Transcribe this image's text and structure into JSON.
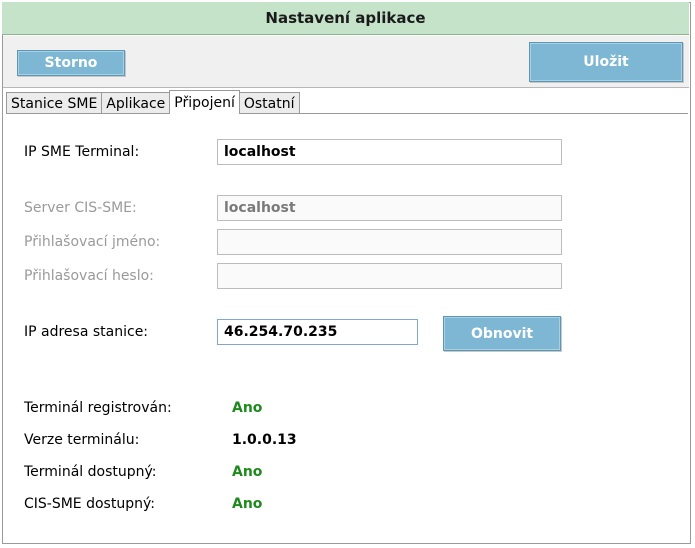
{
  "window": {
    "title": "Nastavení aplikace"
  },
  "toolbar": {
    "cancel_label": "Storno",
    "save_label": "Uložit"
  },
  "tabs": [
    {
      "label": "Stanice SME",
      "active": false
    },
    {
      "label": "Aplikace",
      "active": false
    },
    {
      "label": "Připojení",
      "active": true
    },
    {
      "label": "Ostatní",
      "active": false
    }
  ],
  "connection": {
    "ip_terminal": {
      "label": "IP SME Terminal:",
      "value": "localhost"
    },
    "server": {
      "label": "Server CIS-SME:",
      "value": "localhost",
      "disabled": true
    },
    "login": {
      "label": "Přihlašovací jméno:",
      "value": "",
      "disabled": true
    },
    "password": {
      "label": "Přihlašovací heslo:",
      "value": "",
      "disabled": true
    },
    "station_ip": {
      "label": "IP adresa stanice:",
      "value": "46.254.70.235"
    },
    "refresh_label": "Obnovit"
  },
  "status": {
    "registered": {
      "label": "Terminál registrován:",
      "value": "Ano"
    },
    "version": {
      "label": "Verze terminálu:",
      "value": "1.0.0.13"
    },
    "available": {
      "label": "Terminál dostupný:",
      "value": "Ano"
    },
    "cis_available": {
      "label": "CIS-SME dostupný:",
      "value": "Ano"
    }
  },
  "colors": {
    "title_bg": "#c5e3c9",
    "button": "#7db7d3",
    "ok_green": "#1e8a1e"
  }
}
